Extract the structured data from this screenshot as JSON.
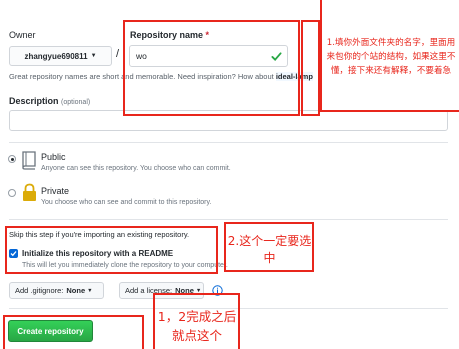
{
  "owner": {
    "label": "Owner",
    "value": "zhangyue690811",
    "separator": "/"
  },
  "repo_name": {
    "label": "Repository name",
    "required_mark": "*",
    "value": "wo"
  },
  "hint": "Great repository names are short and memorable. Need inspiration? How about",
  "hint_suggestion": "ideal-lamp",
  "description": {
    "label": "Description",
    "optional": "(optional)"
  },
  "visibility": {
    "public": {
      "title": "Public",
      "desc": "Anyone can see this repository. You choose who can commit."
    },
    "private": {
      "title": "Private",
      "desc": "You choose who can see and commit to this repository."
    }
  },
  "import_note": "Skip this step if you're importing an existing repository.",
  "init_readme": {
    "title": "Initialize this repository with a README",
    "desc": "This will let you immediately clone the repository to your computer."
  },
  "gitignore": {
    "label": "Add .gitignore:",
    "value": "None"
  },
  "license": {
    "label": "Add a license:",
    "value": "None"
  },
  "create_button": "Create repository",
  "annotations": {
    "a1": "1.填你外面文件夹的名字，里面用来包你的个站的结构，如果这里不懂，接下来还有解释，不要着急",
    "a2": "2.这个一定要选中",
    "a3": "1，2完成之后就点这个"
  },
  "colors": {
    "annotation": "#e8261c",
    "create_button": "#2ea44f",
    "check": "#28a745"
  }
}
